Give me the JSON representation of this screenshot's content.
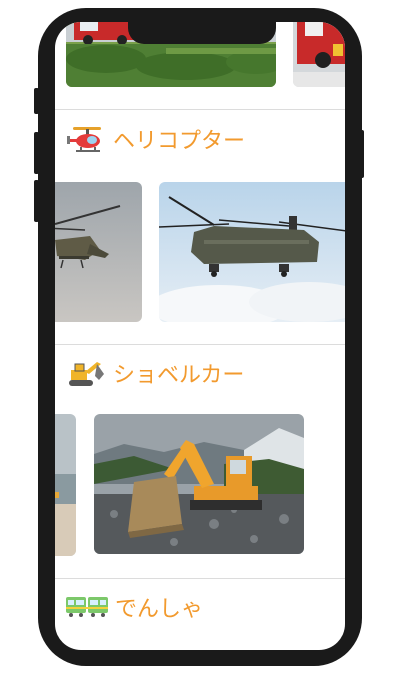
{
  "sections": [
    {
      "emoji_icon": "helicopter-icon",
      "title": "ヘリコプター"
    },
    {
      "emoji_icon": "excavator-icon",
      "title": "ショベルカー"
    },
    {
      "emoji_icon": "train-icon",
      "title": "でんしゃ"
    }
  ],
  "colors": {
    "accent": "#f29a2e",
    "frame": "#1a1a1a",
    "divider": "#dcdcdc"
  }
}
